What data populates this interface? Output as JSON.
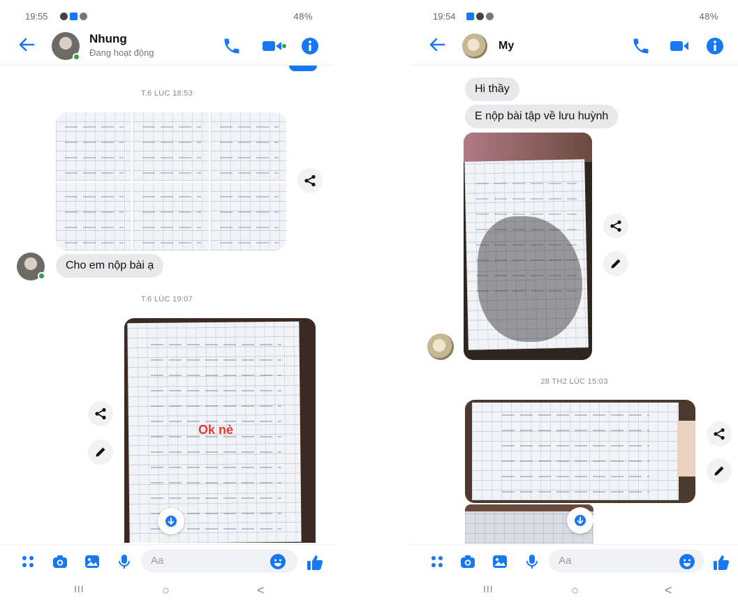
{
  "left": {
    "status": {
      "time": "19:55",
      "right": "48%"
    },
    "header": {
      "name": "Nhung",
      "subtitle": "Đang hoạt động"
    },
    "timestamp1": "T.6 LÚC 18:53",
    "message1": "Cho em nộp bài ạ",
    "timestamp2": "T.6 LÚC 19:07",
    "photo_caption": "Ok nè",
    "composer": {
      "placeholder": "Aa"
    }
  },
  "right": {
    "status": {
      "time": "19:54",
      "right": "48%"
    },
    "header": {
      "name": "My"
    },
    "message1": "Hi thầy",
    "message2": "E nộp bài tập về lưu huỳnh",
    "timestamp1": "28 TH2 LÚC 15:03",
    "composer": {
      "placeholder": "Aa"
    }
  },
  "navbar": {
    "recents": "III",
    "home": "○",
    "back": "<"
  },
  "colors": {
    "accent": "#1877f2",
    "online": "#31a24c",
    "bubble": "#e8e8ea",
    "caption": "#e53935"
  },
  "icons": [
    "back-arrow-icon",
    "phone-icon",
    "video-icon",
    "info-icon",
    "share-icon",
    "edit-icon",
    "download-icon",
    "apps-icon",
    "camera-icon",
    "gallery-icon",
    "mic-icon",
    "emoji-icon",
    "like-icon"
  ]
}
